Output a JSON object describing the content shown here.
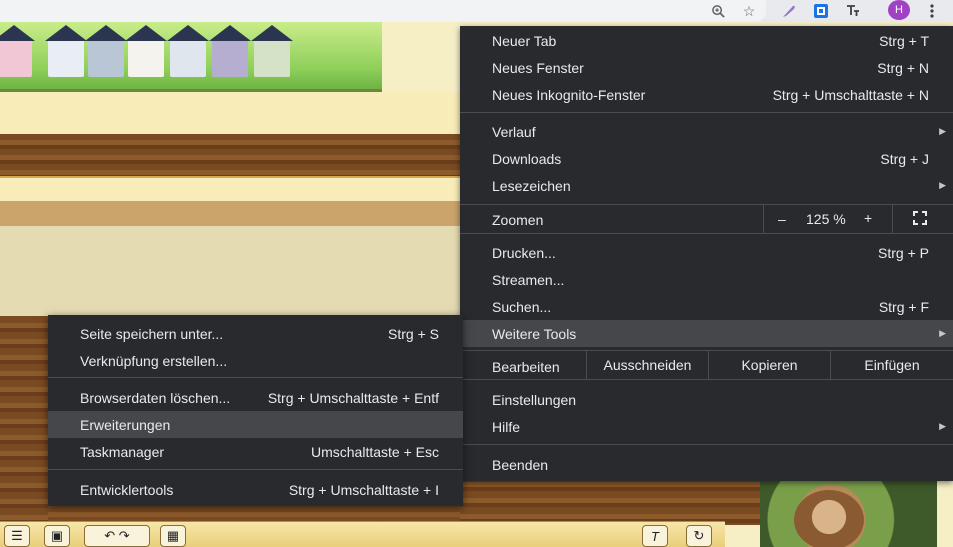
{
  "toolbar": {
    "icons": [
      "zoom-icon",
      "star-icon",
      "extension-feather-icon",
      "extension-translate-icon",
      "extension-text-icon",
      "profile-avatar",
      "more-menu-icon"
    ],
    "avatar_letter": "H"
  },
  "menu": {
    "new_tab": {
      "label": "Neuer Tab",
      "shortcut": "Strg + T"
    },
    "new_window": {
      "label": "Neues Fenster",
      "shortcut": "Strg + N"
    },
    "incognito": {
      "label": "Neues Inkognito-Fenster",
      "shortcut": "Strg + Umschalttaste + N"
    },
    "history": {
      "label": "Verlauf"
    },
    "downloads": {
      "label": "Downloads",
      "shortcut": "Strg + J"
    },
    "bookmarks": {
      "label": "Lesezeichen"
    },
    "zoom": {
      "label": "Zoomen",
      "minus": "–",
      "value": "125 %",
      "plus": "+"
    },
    "print": {
      "label": "Drucken...",
      "shortcut": "Strg + P"
    },
    "cast": {
      "label": "Streamen..."
    },
    "find": {
      "label": "Suchen...",
      "shortcut": "Strg + F"
    },
    "more_tools": {
      "label": "Weitere Tools"
    },
    "edit": {
      "label": "Bearbeiten",
      "cut": "Ausschneiden",
      "copy": "Kopieren",
      "paste": "Einfügen"
    },
    "settings": {
      "label": "Einstellungen"
    },
    "help": {
      "label": "Hilfe"
    },
    "exit": {
      "label": "Beenden"
    }
  },
  "submenu": {
    "save_page": {
      "label": "Seite speichern unter...",
      "shortcut": "Strg + S"
    },
    "create_shortcut": {
      "label": "Verknüpfung erstellen..."
    },
    "clear_data": {
      "label": "Browserdaten löschen...",
      "shortcut": "Strg + Umschalttaste + Entf"
    },
    "extensions": {
      "label": "Erweiterungen"
    },
    "task_manager": {
      "label": "Taskmanager",
      "shortcut": "Umschalttaste + Esc"
    },
    "dev_tools": {
      "label": "Entwicklertools",
      "shortcut": "Strg + Umschalttaste + I"
    }
  },
  "colors": {
    "menu_bg": "#292a2d",
    "menu_highlight": "#45474a",
    "menu_text": "#e8eaed",
    "avatar": "#a142c4"
  }
}
